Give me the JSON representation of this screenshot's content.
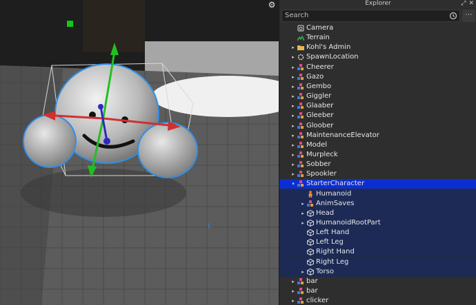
{
  "explorer": {
    "title": "Explorer",
    "search_placeholder": "Search",
    "items": [
      {
        "label": "Camera",
        "icon": "camera-icon",
        "arrow": ""
      },
      {
        "label": "Terrain",
        "icon": "terrain-icon",
        "arrow": ""
      },
      {
        "label": "Kohl's Admin",
        "icon": "folder-icon",
        "arrow": "▸"
      },
      {
        "label": "SpawnLocation",
        "icon": "spawn-icon",
        "arrow": "▸"
      },
      {
        "label": "Cheerer",
        "icon": "model-icon",
        "arrow": "▸"
      },
      {
        "label": "Gazo",
        "icon": "model-icon",
        "arrow": "▸"
      },
      {
        "label": "Gembo",
        "icon": "model-icon",
        "arrow": "▸"
      },
      {
        "label": "Giggler",
        "icon": "model-icon",
        "arrow": "▸"
      },
      {
        "label": "Glaaber",
        "icon": "model-icon",
        "arrow": "▸"
      },
      {
        "label": "Gleeber",
        "icon": "model-icon",
        "arrow": "▸"
      },
      {
        "label": "Gloober",
        "icon": "model-icon",
        "arrow": "▸"
      },
      {
        "label": "MaintenanceElevator",
        "icon": "model-icon",
        "arrow": "▸"
      },
      {
        "label": "Model",
        "icon": "model-icon",
        "arrow": "▸"
      },
      {
        "label": "Murpleck",
        "icon": "model-icon",
        "arrow": "▸"
      },
      {
        "label": "Sobber",
        "icon": "model-icon",
        "arrow": "▸"
      },
      {
        "label": "Spookler",
        "icon": "model-icon",
        "arrow": "▸"
      },
      {
        "label": "StarterCharacter",
        "icon": "model-icon",
        "arrow": "▾"
      },
      {
        "label": "Humanoid",
        "icon": "humanoid-icon",
        "arrow": ""
      },
      {
        "label": "AnimSaves",
        "icon": "model-icon",
        "arrow": "▸"
      },
      {
        "label": "Head",
        "icon": "part-icon",
        "arrow": "▸"
      },
      {
        "label": "HumanoidRootPart",
        "icon": "part-icon",
        "arrow": "▸"
      },
      {
        "label": "Left Hand",
        "icon": "part-icon",
        "arrow": ""
      },
      {
        "label": "Left Leg",
        "icon": "part-icon",
        "arrow": ""
      },
      {
        "label": "Right Hand",
        "icon": "part-icon",
        "arrow": ""
      },
      {
        "label": "Right Leg",
        "icon": "part-icon",
        "arrow": ""
      },
      {
        "label": "Torso",
        "icon": "part-icon",
        "arrow": "▸"
      },
      {
        "label": "bar",
        "icon": "model-icon",
        "arrow": "▸"
      },
      {
        "label": "bar",
        "icon": "model-icon",
        "arrow": "▸"
      },
      {
        "label": "clicker",
        "icon": "model-icon",
        "arrow": "▸"
      }
    ]
  },
  "colors": {
    "selection": "#0b2ed4",
    "selected_children": "#1c2a55",
    "panel_bg": "#2e2e2e"
  }
}
